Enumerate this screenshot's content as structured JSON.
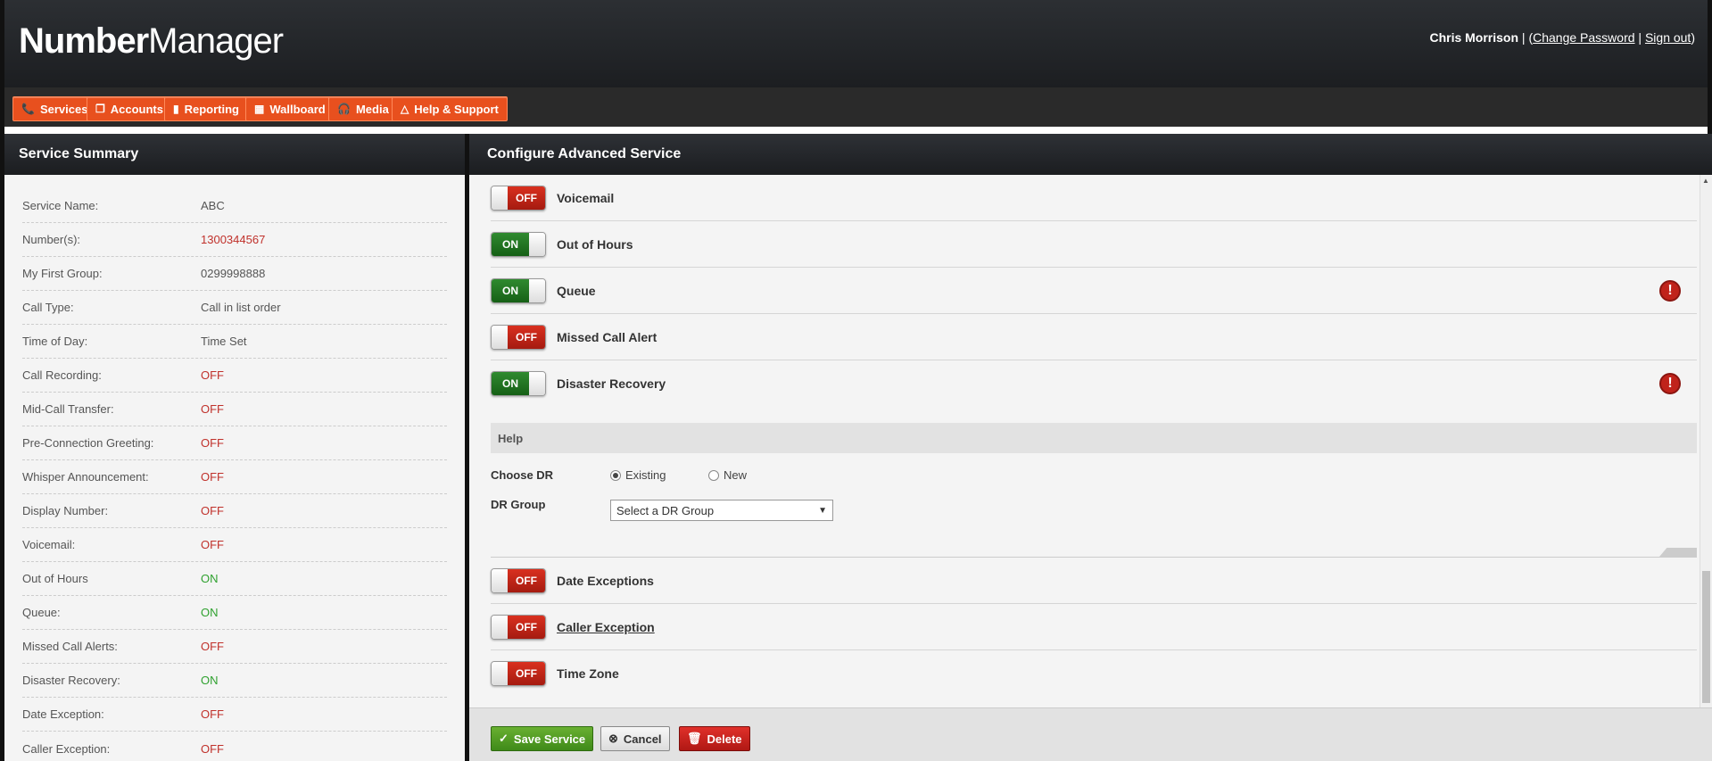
{
  "header": {
    "logo_bold": "Number",
    "logo_light": "Manager",
    "user_name": "Chris Morrison",
    "sep1": " | (",
    "change_password": "Change Password",
    "sep2": " | ",
    "sign_out": "Sign out",
    "sep3": ")"
  },
  "nav": {
    "services": "Services",
    "accounts": "Accounts",
    "reporting": "Reporting",
    "wallboard": "Wallboard",
    "media": "Media",
    "help_support": "Help & Support"
  },
  "left": {
    "title": "Service Summary",
    "rows": [
      {
        "k": "Service Name:",
        "v": "ABC"
      },
      {
        "k": "Number(s):",
        "v": "1300344567"
      },
      {
        "k": "My First Group:",
        "v": "0299998888"
      },
      {
        "k": "Call Type:",
        "v": "Call in list order"
      },
      {
        "k": "Time of Day:",
        "v": "Time Set"
      },
      {
        "k": "Call Recording:",
        "v": "OFF"
      },
      {
        "k": "Mid-Call Transfer:",
        "v": "OFF"
      },
      {
        "k": "Pre-Connection Greeting:",
        "v": "OFF"
      },
      {
        "k": "Whisper Announcement:",
        "v": "OFF"
      },
      {
        "k": "Display Number:",
        "v": "OFF"
      },
      {
        "k": "Voicemail:",
        "v": "OFF"
      },
      {
        "k": "Out of Hours",
        "v": "ON"
      },
      {
        "k": "Queue:",
        "v": "ON"
      },
      {
        "k": "Missed Call Alerts:",
        "v": "OFF"
      },
      {
        "k": "Disaster Recovery:",
        "v": "ON"
      },
      {
        "k": "Date Exception:",
        "v": "OFF"
      },
      {
        "k": "Caller Exception:",
        "v": "OFF"
      }
    ]
  },
  "right": {
    "title": "Configure Advanced Service",
    "options": [
      {
        "state": "OFF",
        "label": "Voicemail"
      },
      {
        "state": "ON",
        "label": "Out of Hours"
      },
      {
        "state": "ON",
        "label": "Queue"
      },
      {
        "state": "OFF",
        "label": "Missed Call Alert"
      },
      {
        "state": "ON",
        "label": "Disaster Recovery"
      },
      {
        "state": "OFF",
        "label": "Date Exceptions"
      },
      {
        "state": "OFF",
        "label": "Caller Exception"
      },
      {
        "state": "OFF",
        "label": "Time Zone"
      }
    ],
    "alert_glyph": "!",
    "help": "Help",
    "choose_dr": "Choose DR",
    "existing": "Existing",
    "new": "New",
    "dr_group": "DR Group",
    "dr_select": "Select a DR Group"
  },
  "footer": {
    "save": "Save Service",
    "cancel": "Cancel",
    "delete": "Delete"
  },
  "colors": {
    "nav_orange": "#e8501e",
    "on_green": "#2f8a2f",
    "off_red": "#c0312b"
  }
}
